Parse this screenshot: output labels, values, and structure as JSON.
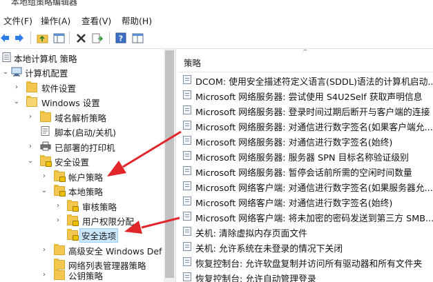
{
  "window": {
    "title": "本地组策略编辑器"
  },
  "menu": [
    {
      "label": "文件(F)"
    },
    {
      "label": "操作(A)"
    },
    {
      "label": "查看(V)"
    },
    {
      "label": "帮助(H)"
    }
  ],
  "tree": {
    "root": "本地计算机 策略",
    "computer_config": "计算机配置",
    "software_settings": "软件设置",
    "windows_settings": "Windows 设置",
    "dns_policy": "域名解析策略",
    "scripts": "脚本(启动/关机)",
    "printers": "已部署的打印机",
    "security_settings": "安全设置",
    "account_policy": "帐户策略",
    "local_policy": "本地策略",
    "audit_policy": "审核策略",
    "user_rights": "用户权限分配",
    "security_options": "安全选项",
    "firewall": "高级安全 Windows Def",
    "network_list": "网络列表管理器策略",
    "public_key": "公钥策略"
  },
  "list": {
    "header": "策略",
    "rows": [
      "DCOM: 使用安全描述符定义语言(SDDL)语法的计算机启动...",
      "Microsoft 网络服务器: 尝试使用 S4U2Self 获取声明信息",
      "Microsoft 网络服务器: 登录时间过期后断开与客户端的连接",
      "Microsoft 网络服务器: 对通信进行数字签名(如果客户端允...",
      "Microsoft 网络服务器: 对通信进行数字签名(始终)",
      "Microsoft 网络服务器: 服务器 SPN 目标名称验证级别",
      "Microsoft 网络服务器: 暂停会话前所需的空闲时间数量",
      "Microsoft 网络客户端: 对通信进行数字签名(如果服务器允...",
      "Microsoft 网络客户端: 对通信进行数字签名(始终)",
      "Microsoft 网络客户端: 将未加密的密码发送到第三方 SMB...",
      "关机: 清除虚拟内存页面文件",
      "关机: 允许系统在未登录的情况下关闭",
      "恢复控制台: 允许软盘复制并访问所有驱动器和所有文件夹",
      "恢复控制台: 允许自动管理登录"
    ]
  },
  "colors": {
    "arrow": "#e0262b",
    "selection": "#cce8ff",
    "folder": "#f3c74e"
  }
}
